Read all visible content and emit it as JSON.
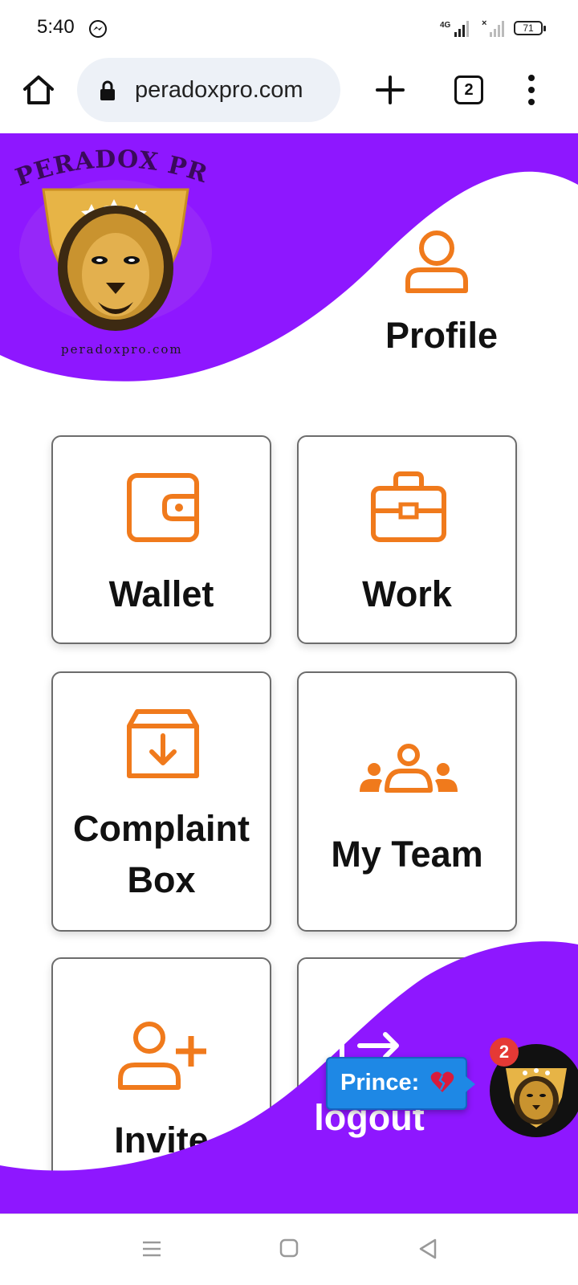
{
  "status_bar": {
    "time": "5:40",
    "battery": "71",
    "network": "4G"
  },
  "browser": {
    "url": "peradoxpro.com",
    "tab_count": "2",
    "icons": [
      "home-icon",
      "lock-icon",
      "plus-icon",
      "tabs-icon",
      "more-vert-icon"
    ]
  },
  "logo": {
    "name": "PERADOX PRO",
    "url_text": "peradoxpro.com"
  },
  "menu": {
    "profile": "Profile",
    "wallet": "Wallet",
    "work": "Work",
    "complaint_line1": "Complaint",
    "complaint_line2": "Box",
    "my_team": "My Team",
    "invite": "Invite",
    "logout": "logout"
  },
  "chat": {
    "sender": "Prince:",
    "unread": "2"
  },
  "colors": {
    "brand_purple": "#8e17ff",
    "icon_orange": "#f07a1c",
    "chat_blue": "#1e88e5",
    "badge_red": "#e53935"
  }
}
